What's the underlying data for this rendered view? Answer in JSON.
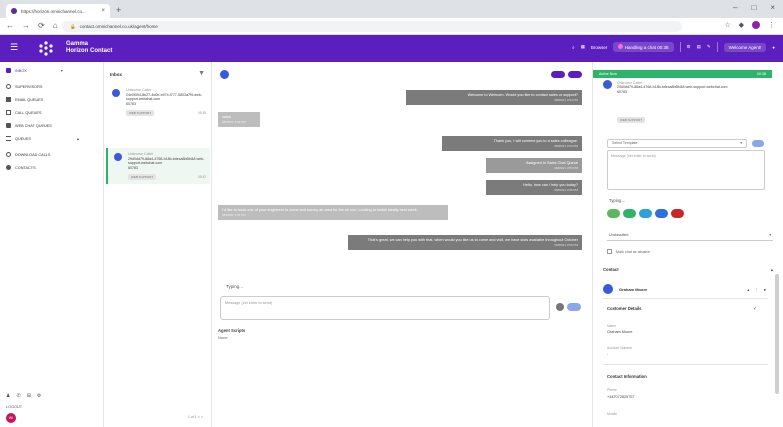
{
  "browser": {
    "tab_title": "https://horizon.omnichannel.co...",
    "tab_close": "×",
    "new_tab": "+",
    "address": "contact.omnichannel.co.uk/agent/home",
    "win_controls": [
      "–",
      "□",
      "×"
    ]
  },
  "app": {
    "brand_line1": "Gamma",
    "brand_line2": "Horizon Contact",
    "header": {
      "status_label": "Browser",
      "handling": "Handling a chat 00:38",
      "agent": "Welcome Agent!"
    }
  },
  "sidebar": {
    "items": [
      {
        "label": "INBOX",
        "icon": "inbox-icon"
      },
      {
        "label": "SUPERVISORS",
        "icon": "people-icon"
      },
      {
        "label": "EMAIL QUEUES",
        "icon": "mail-icon"
      },
      {
        "label": "CALL QUEUES",
        "icon": "phone-icon"
      },
      {
        "label": "WEB CHAT QUEUES",
        "icon": "chat-icon"
      },
      {
        "label": "QUEUES",
        "icon": "queue-icon"
      },
      {
        "label": "DOWNLOAD CALLS",
        "icon": "download-icon"
      },
      {
        "label": "CONTACTS",
        "icon": "contacts-icon"
      }
    ],
    "logout": "LOGOUT",
    "avatar_initials": "WI"
  },
  "inbox": {
    "title": "Inbox",
    "conversations": [
      {
        "name": "Unknown Caller",
        "id": "24e0f594-8b27-4d0b-b974-f777-5803a7f9-web-support.webchat.com",
        "port": "60783",
        "tag": "WEB SUPPORT",
        "time": "05:38"
      },
      {
        "name": "Unknown Caller",
        "id": "29d0dd79-88a4-4768-b18b-bdeca8b6fd48 web-support.webchat.com",
        "port": "60783",
        "tag": "WEB SUPPORT",
        "time": "05:43"
      }
    ],
    "pager": "1 of 1 < >"
  },
  "chat": {
    "messages": [
      {
        "text": "Welcome to Webcom. Would you like to contact sales or support?",
        "time": "08/09/21 3:54 PM"
      },
      {
        "text": "sales",
        "time": "08/09/21 3:54 PM"
      },
      {
        "text": "Thank you, I will connect you to a sales colleague.",
        "time": "08/09/21 3:54 PM"
      },
      {
        "text": "Assigned to Sales Chat Queue",
        "time": "08/09/21 3:55 PM"
      },
      {
        "text": "Hello, how can I help you today?",
        "time": "08/09/21 3:55 PM"
      },
      {
        "text": "I'd like to book one of your engineers to come and survey an area for the air con. Looking to install ideally next week.",
        "time": "08/09/21 3:55 PM"
      },
      {
        "text": "That's great, we can help you with that, when would you like us to come and visit, we have slots available throughout October",
        "time": "08/09/21 3:56 PM"
      }
    ],
    "typing": "Typing...",
    "composer_placeholder": "Message (ctrl enter to send)",
    "scripts_title": "Agent Scripts",
    "scripts_value": "None"
  },
  "right": {
    "head_label": "Active Now",
    "head_time": "00:38",
    "caller_name": "Unknown Caller",
    "caller_id": "29d0dd79-88a4-4768-b18b-bdeca8b6fd48 web-support.webchat.com",
    "caller_port": "60783",
    "caller_tag": "WEB SUPPORT",
    "template_placeholder": "Select Template",
    "note_placeholder": "Message (ctrl enter to send)",
    "typing": "Typing...",
    "disposition": "Unclassified",
    "abandon_label": "Mark chat as abusive",
    "contact_title": "Contact",
    "contact_name": "Graham Moore",
    "customer_details": "Customer Details",
    "name_label": "Name",
    "name_value": "Graham Moore",
    "account_label": "Account Number",
    "account_value": "-",
    "contact_info": "Contact Information",
    "phone_label": "Phone",
    "phone_value": "+447072825757",
    "mobile_label": "Mobile"
  },
  "colors": {
    "brand": "#5c1fbf",
    "active": "#2fb36b",
    "agent_bubble": "#7b7b7b",
    "customer_bubble": "#bdbdbd"
  }
}
